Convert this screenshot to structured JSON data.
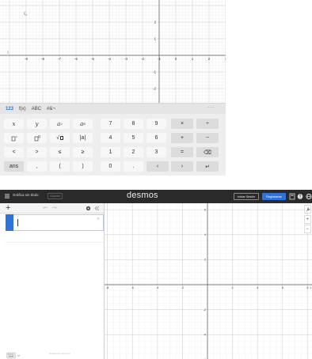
{
  "mobile_graph": {
    "x_ticks": [
      "-9",
      "-8",
      "-7",
      "-6",
      "-5",
      "-4",
      "-3",
      "-2",
      "-1",
      "0",
      "1",
      "2",
      "3"
    ],
    "y_ticks": [
      "2",
      "1",
      "-1",
      "-2"
    ]
  },
  "keypad": {
    "tabs": [
      "123",
      "f(x)",
      "ABC",
      "#&¬"
    ],
    "more_label": "···",
    "row1": [
      "x",
      "y",
      "a",
      "a",
      "7",
      "8",
      "9",
      "×",
      "÷"
    ],
    "row2": [
      "a",
      "a",
      "√",
      "|a|",
      "4",
      "5",
      "6",
      "+",
      "−"
    ],
    "row3": [
      "<",
      ">",
      "≤",
      "≥",
      "1",
      "2",
      "3",
      "=",
      "⌫"
    ],
    "row4": [
      "ans",
      ",",
      "(",
      ")",
      "0",
      ".",
      "‹",
      "›",
      "↵"
    ]
  },
  "header": {
    "graph_title": "Gráfica sin título",
    "save_label": "Guardar",
    "brand": "desmos",
    "login_label": "Iniciar Sesión",
    "signup_label": "Registrarse"
  },
  "expression": {
    "value": "",
    "placeholder": ""
  },
  "desktop_graph": {
    "x_ticks": [
      "-10",
      "-8",
      "-6",
      "-4",
      "-2",
      "2",
      "4",
      "6",
      "8",
      "1"
    ],
    "y_ticks": [
      "6",
      "4",
      "2",
      "-2",
      "-4",
      "-6"
    ]
  },
  "powered_by": "powered by desmos",
  "colors": {
    "accent": "#2f72dc",
    "header_bg": "#2a2a2a",
    "grid_minor": "#ececec",
    "grid_major": "#cfcfcf"
  }
}
